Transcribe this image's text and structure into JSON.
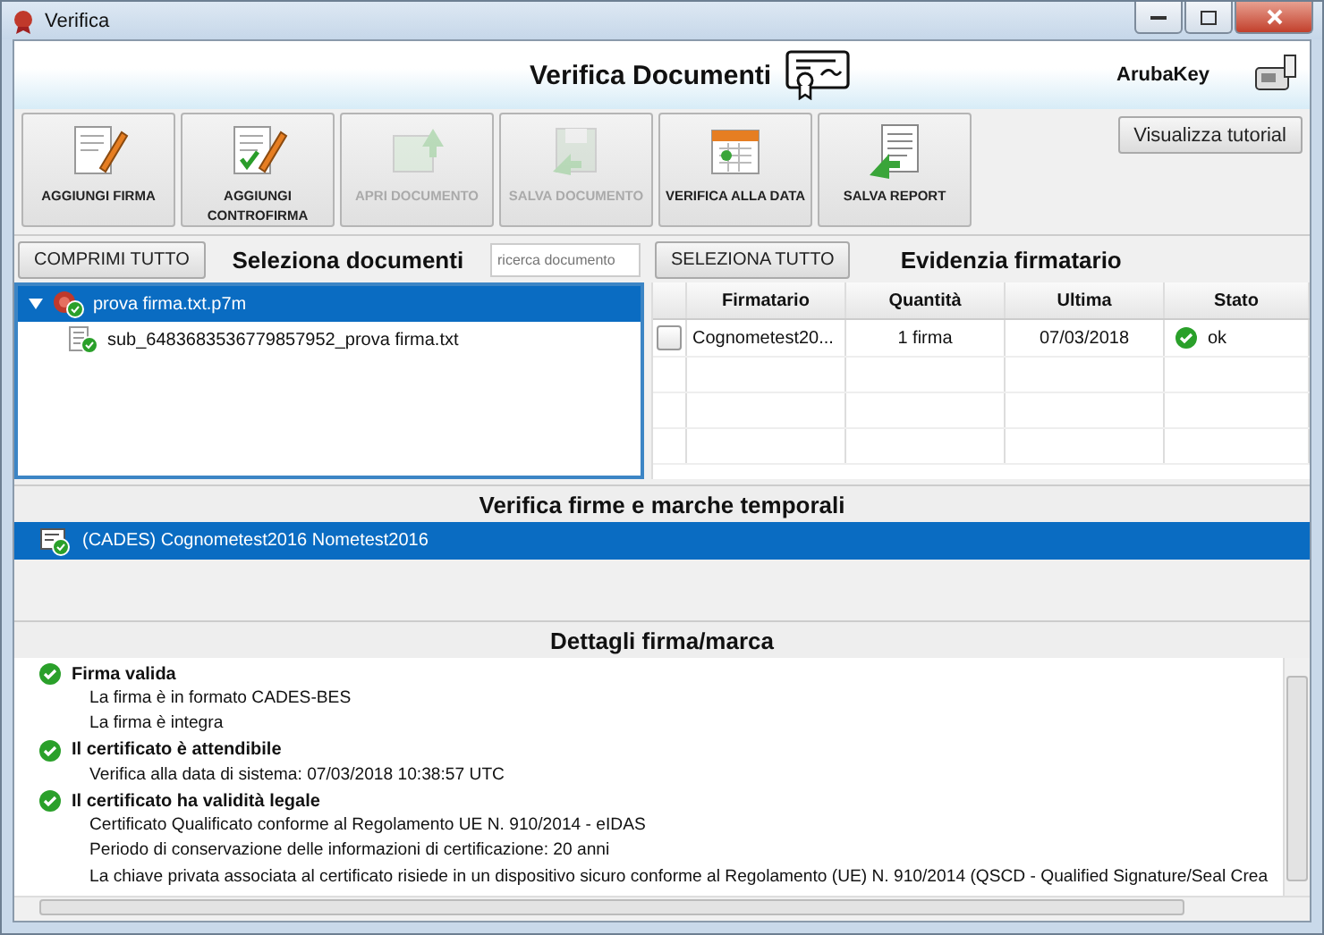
{
  "window": {
    "title": "Verifica"
  },
  "header": {
    "title": "Verifica Documenti",
    "brand": "ArubaKey"
  },
  "toolbar": [
    {
      "label": "AGGIUNGI FIRMA",
      "kind": "sign",
      "disabled": false
    },
    {
      "label": "AGGIUNGI CONTROFIRMA",
      "kind": "countersign",
      "disabled": false
    },
    {
      "label": "APRI DOCUMENTO",
      "kind": "open",
      "disabled": true
    },
    {
      "label": "SALVA DOCUMENTO",
      "kind": "save",
      "disabled": true
    },
    {
      "label": "VERIFICA ALLA DATA",
      "kind": "calendar",
      "disabled": false
    },
    {
      "label": "SALVA REPORT",
      "kind": "report",
      "disabled": false
    }
  ],
  "tutorial_button": "Visualizza tutorial",
  "documents": {
    "collapse_button": "COMPRIMI TUTTO",
    "title": "Seleziona documenti",
    "search": {
      "placeholder": "ricerca documento"
    },
    "tree": [
      {
        "label": "prova firma.txt.p7m",
        "expanded": true,
        "selected": true,
        "children": [
          {
            "label": "sub_6483683536779857952_prova firma.txt",
            "selected": false
          }
        ]
      }
    ]
  },
  "signers": {
    "select_all_button": "SELEZIONA TUTTO",
    "title": "Evidenzia firmatario",
    "columns": [
      "Firmatario",
      "Quantità",
      "Ultima",
      "Stato"
    ],
    "rows": [
      {
        "checked": false,
        "signer": "Cognometest20...",
        "quantity": "1 firma",
        "last": "07/03/2018",
        "status": "ok"
      }
    ]
  },
  "signatures": {
    "title": "Verifica firme e marche temporali",
    "items": [
      {
        "label": "(CADES) Cognometest2016 Nometest2016",
        "selected": true
      }
    ]
  },
  "details": {
    "title": "Dettagli firma/marca",
    "groups": [
      {
        "title": "Firma valida",
        "valid": true,
        "lines": [
          "La firma è in formato CADES-BES",
          "La firma è integra"
        ]
      },
      {
        "title": "Il certificato è attendibile",
        "valid": true,
        "lines": [
          "Verifica alla data di sistema: 07/03/2018 10:38:57 UTC"
        ]
      },
      {
        "title": "Il certificato ha validità legale",
        "valid": true,
        "lines": [
          "Certificato Qualificato conforme al Regolamento UE N. 910/2014 - eIDAS",
          "Periodo di conservazione delle informazioni di certificazione: 20 anni",
          "La chiave privata associata al certificato risiede in un dispositivo sicuro conforme al Regolamento (UE) N. 910/2014 (QSCD - Qualified Signature/Seal Crea"
        ]
      }
    ]
  }
}
